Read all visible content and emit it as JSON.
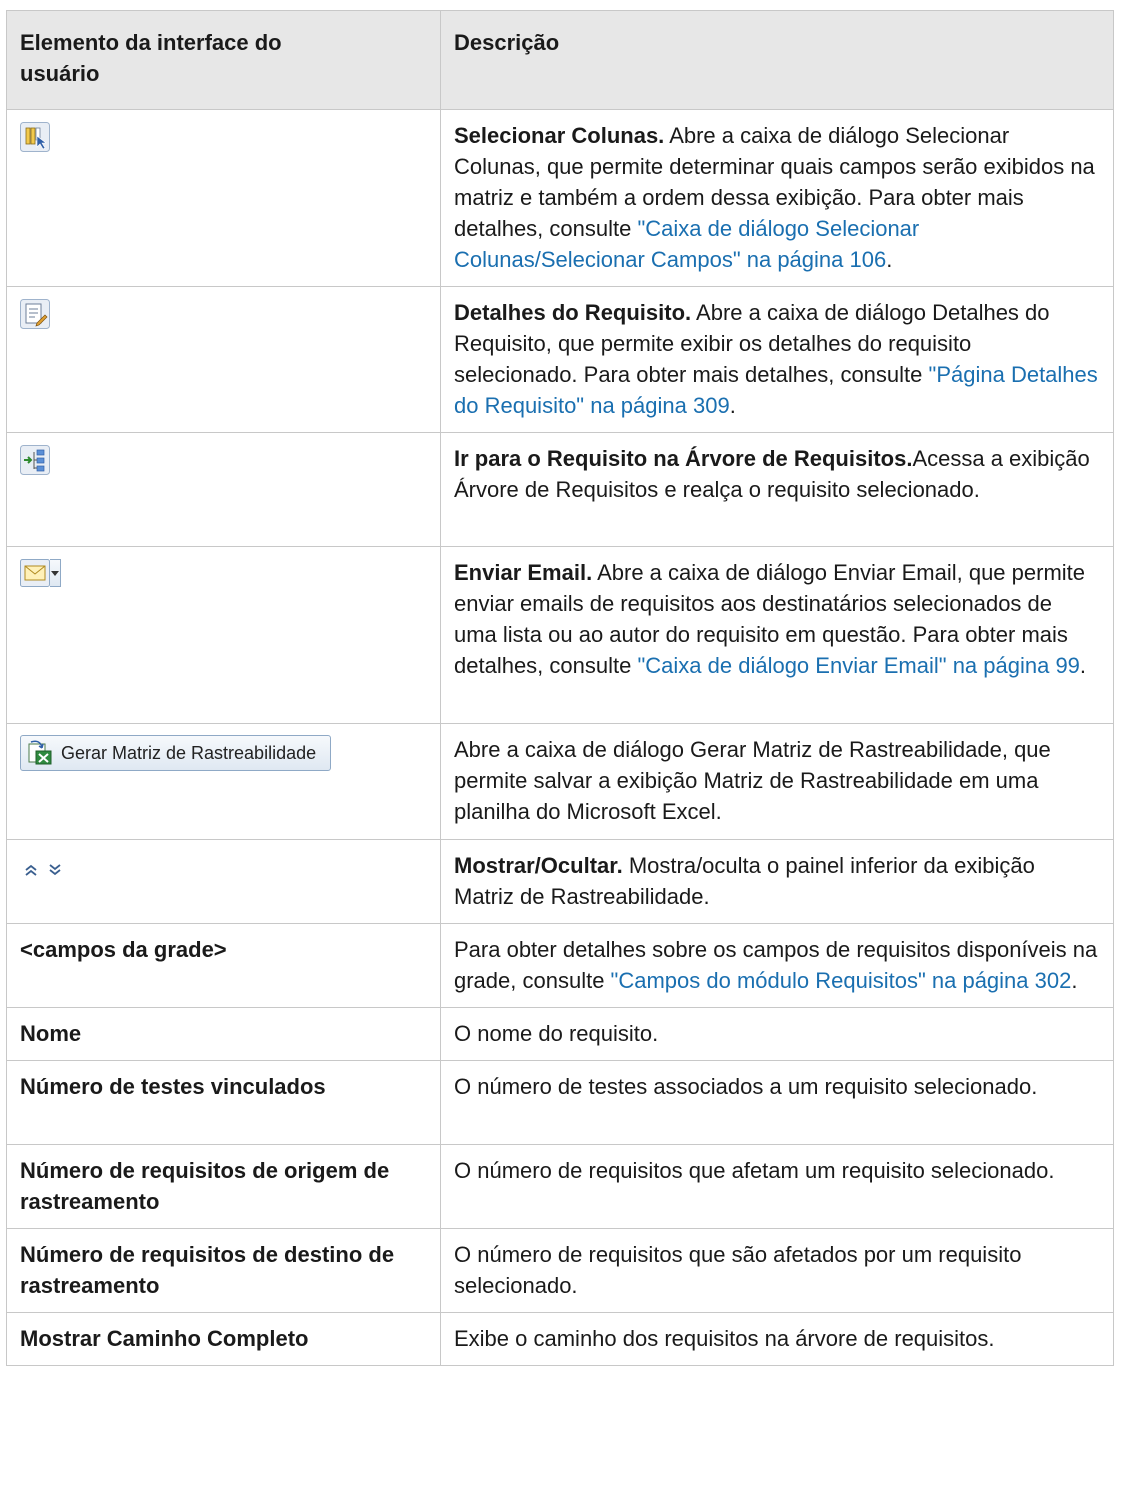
{
  "table": {
    "header": {
      "col1": "Elemento da interface do usuário",
      "col2": "Descrição"
    },
    "rows": [
      {
        "icon": "select-columns-icon",
        "title": "Selecionar Colunas.",
        "text": " Abre a caixa de diálogo Selecionar Colunas, que permite determinar quais campos serão exibidos na matriz e também a ordem dessa exibição. Para obter mais detalhes, consulte ",
        "link": "\"Caixa de diálogo Selecionar Colunas/Selecionar Campos\" na página 106",
        "end": "."
      },
      {
        "icon": "requirement-details-icon",
        "title": "Detalhes do Requisito.",
        "text": " Abre a caixa de diálogo Detalhes do Requisito, que permite exibir os detalhes do requisito selecionado. Para obter mais detalhes, consulte ",
        "link": "\"Página Detalhes do Requisito\" na página 309",
        "end": "."
      },
      {
        "icon": "go-to-requirement-tree-icon",
        "title": "Ir para o Requisito na Árvore de Requisitos.",
        "text": "Acessa a exibição Árvore de Requisitos e realça o requisito selecionado."
      },
      {
        "icon": "send-email-icon",
        "title": "Enviar Email.",
        "text": " Abre a caixa de diálogo Enviar Email, que permite enviar emails de requisitos aos destinatários selecionados de uma lista ou ao autor do requisito em questão. Para obter mais detalhes, consulte ",
        "link": "\"Caixa de diálogo Enviar Email\" na página 99",
        "end": "."
      },
      {
        "icon": "excel-export-icon",
        "button_label": "Gerar Matriz de Rastreabilidade",
        "text": "Abre a caixa de diálogo Gerar Matriz de Rastreabilidade, que permite salvar a exibição Matriz de Rastreabilidade em uma planilha do Microsoft Excel."
      },
      {
        "icon": "show-hide-icon",
        "title": "Mostrar/Ocultar.",
        "text": " Mostra/oculta o painel inferior da exibição Matriz de Rastreabilidade."
      },
      {
        "name": "<campos da grade>",
        "text": "Para obter detalhes sobre os campos de requisitos disponíveis na grade, consulte ",
        "link": "\"Campos do módulo Requisitos\" na página 302",
        "end": "."
      },
      {
        "name": "Nome",
        "text": "O nome do requisito."
      },
      {
        "name": "Número de testes vinculados",
        "text": "O número de testes associados a um requisito selecionado."
      },
      {
        "name": "Número de requisitos de origem de rastreamento",
        "text": "O número de requisitos que afetam um requisito selecionado."
      },
      {
        "name": "Número de requisitos de destino de rastreamento",
        "text": "O número de requisitos que são afetados por um requisito selecionado."
      },
      {
        "name": "Mostrar Caminho Completo",
        "text": "Exibe o caminho dos requisitos na árvore de requisitos."
      }
    ]
  }
}
